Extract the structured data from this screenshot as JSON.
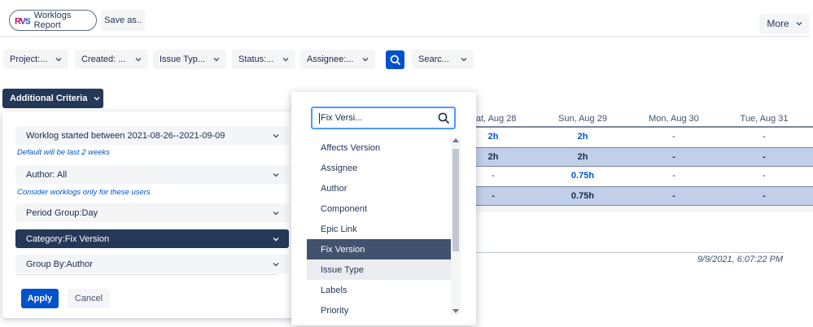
{
  "header": {
    "logo_text": "Worklogs Report",
    "save_label": "Save as..",
    "more_label": "More"
  },
  "filters": [
    {
      "label": "Project:..."
    },
    {
      "label": "Created: ..."
    },
    {
      "label": "Issue Typ..."
    },
    {
      "label": "Status:..."
    },
    {
      "label": "Assignee:..."
    },
    {
      "label": "Searc..."
    }
  ],
  "additional_criteria_label": "Additional Criteria",
  "table": {
    "columns": [
      "Sat, Aug 28",
      "Sun, Aug 29",
      "Mon, Aug 30",
      "Tue, Aug 31"
    ],
    "rows": [
      [
        "2h",
        "2h",
        "-",
        "-"
      ],
      [
        "2h",
        "2h",
        "-",
        "-"
      ],
      [
        "-",
        "0.75h",
        "-",
        "-"
      ],
      [
        "-",
        "0.75h",
        "-",
        "-"
      ]
    ],
    "timestamp": "9/9/2021, 6:07:22 PM"
  },
  "criteria": {
    "items": [
      {
        "label": "Worklog started between 2021-08-26--2021-09-09",
        "hint": "Default will be last 2 weeks"
      },
      {
        "label": "Author: All",
        "hint": "Consider worklogs only for these users"
      },
      {
        "label": "Period Group:Day",
        "hint": ""
      },
      {
        "label": "Category:Fix Version",
        "hint": ""
      },
      {
        "label": "Group By:Author",
        "hint": ""
      }
    ],
    "apply_label": "Apply",
    "cancel_label": "Cancel"
  },
  "dropdown": {
    "search_value": "Fix Versi...",
    "options": [
      "Affects Version",
      "Assignee",
      "Author",
      "Component",
      "Epic Link",
      "Fix Version",
      "Issue Type",
      "Labels",
      "Priority"
    ],
    "selected": "Fix Version"
  },
  "colors": {
    "accent": "#0052cc",
    "navy": "#253858",
    "highlight_row": "#c1cfe8"
  }
}
